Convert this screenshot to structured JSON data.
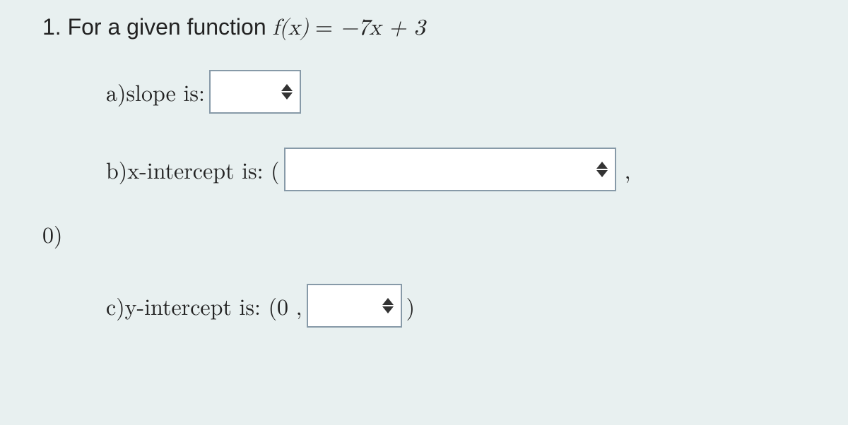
{
  "question": {
    "number": "1.",
    "stem_prefix": "For a given function ",
    "function_lhs": "f(x)",
    "equals": " = ",
    "function_rhs": "−7x + 3"
  },
  "parts": {
    "a": {
      "label": "a)slope is:"
    },
    "b": {
      "label": "b)x-intercept is: (",
      "after_input": ",",
      "continuation": "0)"
    },
    "c": {
      "label": "c)y-intercept is: (0 ,",
      "after_input": ")"
    }
  }
}
